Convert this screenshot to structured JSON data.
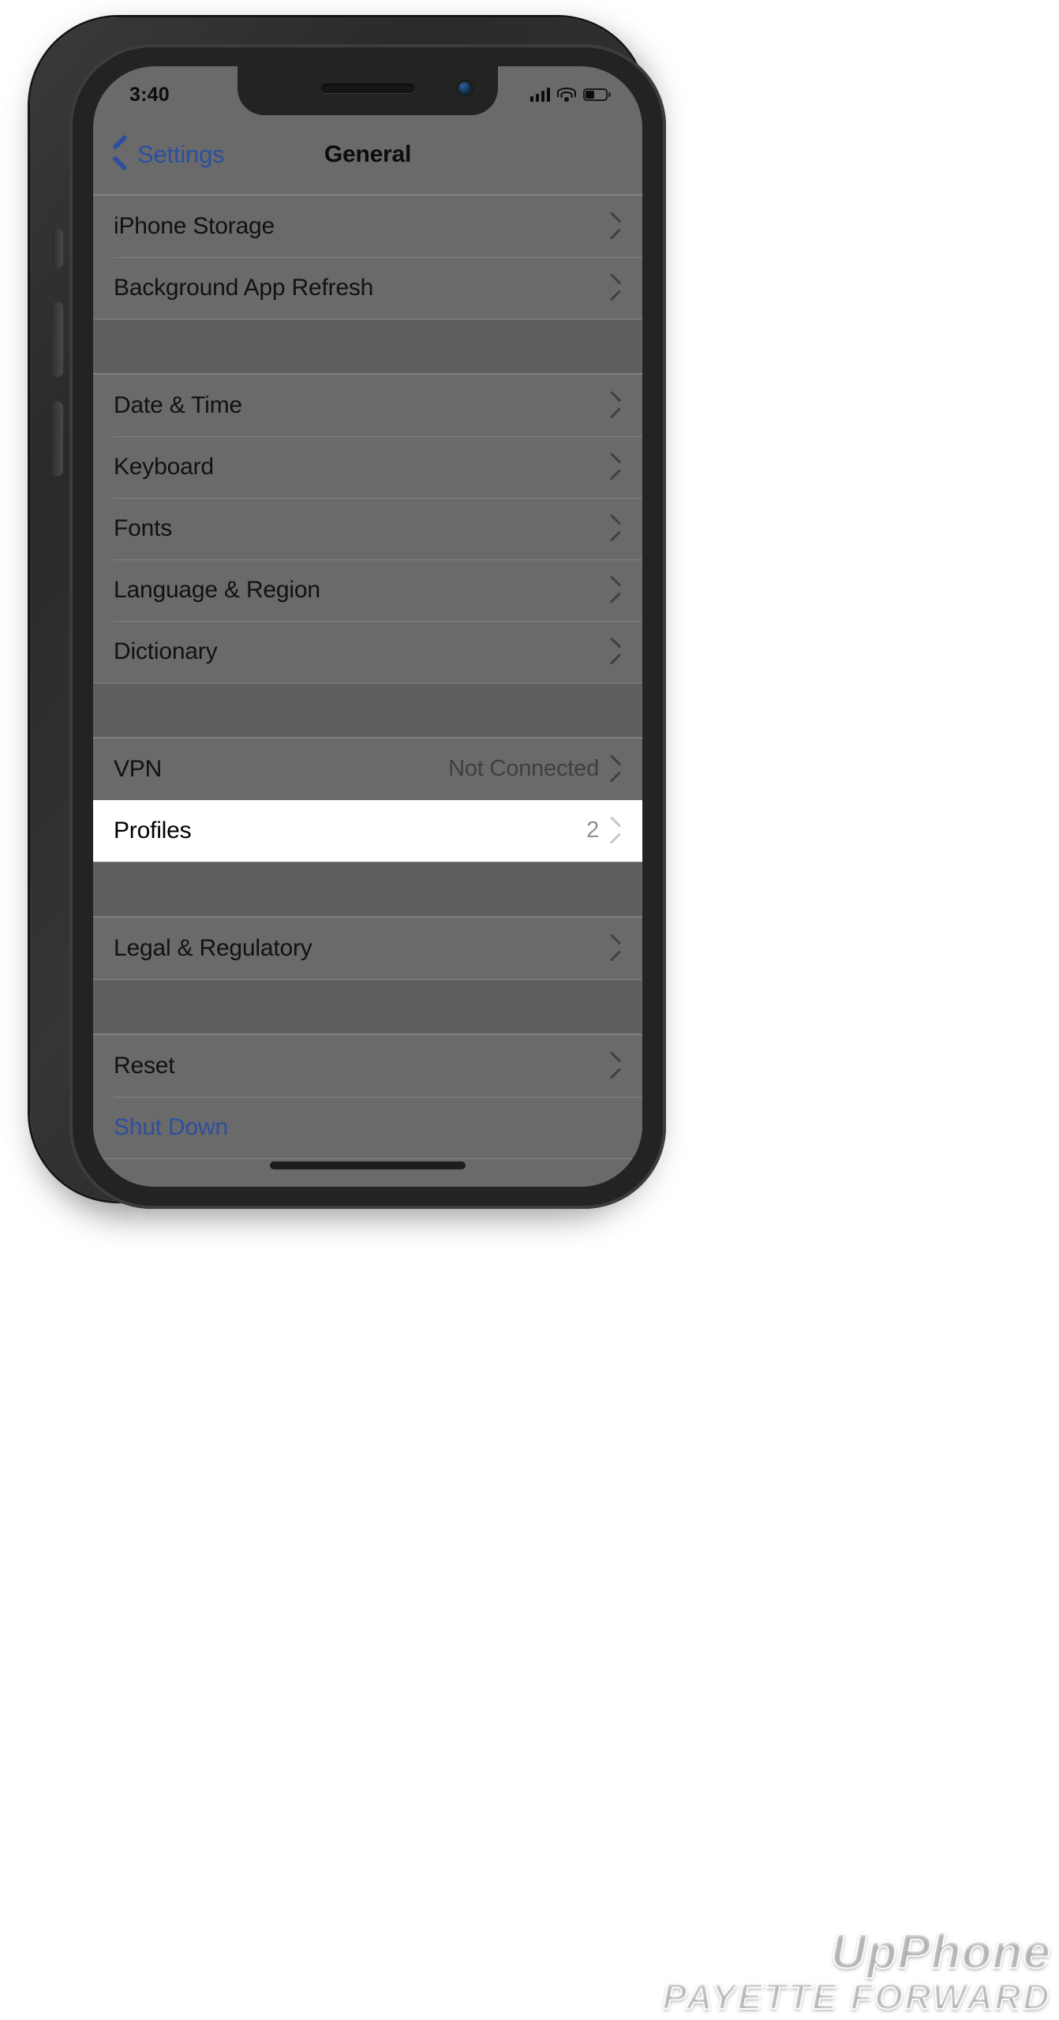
{
  "status_bar": {
    "time": "3:40",
    "signal_icon": "cellular-signal-icon",
    "wifi_icon": "wifi-icon",
    "battery_icon": "battery-icon"
  },
  "nav": {
    "back_label": "Settings",
    "back_icon": "chevron-left-icon",
    "title": "General"
  },
  "colors": {
    "tint_blue": "#2c4f9e",
    "dimmed_background": "#6a6a6a",
    "group_gap": "#5f5f5f",
    "highlight_background": "#ffffff",
    "label_black": "#111111"
  },
  "groups": [
    {
      "name": "storage-group",
      "rows": [
        {
          "label": "iPhone Storage",
          "value": "",
          "accessory": "chevron-right-icon",
          "style": "default"
        },
        {
          "label": "Background App Refresh",
          "value": "",
          "accessory": "chevron-right-icon",
          "style": "default"
        }
      ]
    },
    {
      "name": "localization-group",
      "rows": [
        {
          "label": "Date & Time",
          "value": "",
          "accessory": "chevron-right-icon",
          "style": "default"
        },
        {
          "label": "Keyboard",
          "value": "",
          "accessory": "chevron-right-icon",
          "style": "default"
        },
        {
          "label": "Fonts",
          "value": "",
          "accessory": "chevron-right-icon",
          "style": "default"
        },
        {
          "label": "Language & Region",
          "value": "",
          "accessory": "chevron-right-icon",
          "style": "default"
        },
        {
          "label": "Dictionary",
          "value": "",
          "accessory": "chevron-right-icon",
          "style": "default"
        }
      ]
    },
    {
      "name": "vpn-profiles-group",
      "rows": [
        {
          "label": "VPN",
          "value": "Not Connected",
          "accessory": "chevron-right-icon",
          "style": "default"
        },
        {
          "label": "Profiles",
          "value": "2",
          "accessory": "chevron-right-icon",
          "style": "highlight"
        }
      ]
    },
    {
      "name": "legal-group",
      "rows": [
        {
          "label": "Legal & Regulatory",
          "value": "",
          "accessory": "chevron-right-icon",
          "style": "default"
        }
      ]
    },
    {
      "name": "reset-group",
      "rows": [
        {
          "label": "Reset",
          "value": "",
          "accessory": "chevron-right-icon",
          "style": "default"
        },
        {
          "label": "Shut Down",
          "value": "",
          "accessory": "",
          "style": "blue"
        }
      ]
    }
  ],
  "watermark": {
    "line1": "UpPhone",
    "line2": "PAYETTE FORWARD"
  },
  "device": {
    "home_indicator": "home-indicator",
    "notch": "notch",
    "speaker": "earpiece-speaker",
    "front_camera": "front-camera-icon"
  }
}
